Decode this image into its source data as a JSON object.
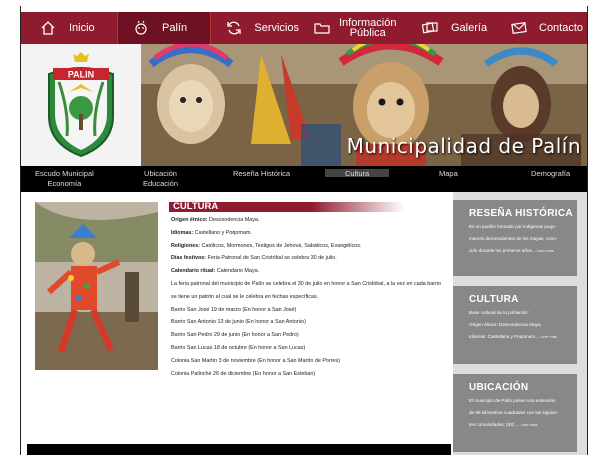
{
  "nav": {
    "items": [
      {
        "label": "Inicio",
        "icon": "house-icon"
      },
      {
        "label": "Palín",
        "icon": "mask-icon"
      },
      {
        "label": "Servicios",
        "icon": "refresh-icon"
      },
      {
        "label_line1": "Información",
        "label_line2": "Pública",
        "icon": "folder-icon"
      },
      {
        "label": "Galería",
        "icon": "photos-icon"
      },
      {
        "label": "Contacto",
        "icon": "envelope-icon"
      }
    ],
    "active_index": 1
  },
  "banner": {
    "title": "Municipalidad de Palín",
    "logo_text": "PALIN"
  },
  "subnav": {
    "items": [
      {
        "line1": "Escudo Municipal",
        "line2": "Economía"
      },
      {
        "line1": "Ubicación",
        "line2": "Educación"
      },
      {
        "line1": "Reseña Histórica",
        "line2": ""
      },
      {
        "line1": "Cultura",
        "line2": ""
      },
      {
        "line1": "Mapa",
        "line2": ""
      },
      {
        "line1": "Demografía",
        "line2": ""
      }
    ],
    "active_index": 3
  },
  "cultura": {
    "heading": "CULTURA",
    "rows": [
      {
        "label": "Origen étnico:",
        "value": "Descendencia Maya."
      },
      {
        "label": "Idiomas:",
        "value": "Castellano y Poqomam."
      },
      {
        "label": "Religiones:",
        "value": "Católicos, Mormones, Testigos de Jehová, Sabáticos, Evangélicos."
      },
      {
        "label": "Días festivos:",
        "value": "Feria Patronal de San Cristóbal se celebra 30 de julio."
      },
      {
        "label": "Calendario ritual:",
        "value": "Calendario Maya."
      }
    ],
    "paragraph_line1": "La feria patronal del municipio de Palín se celebra el 30 de julio en honor a San Cristóbal, a la vez en cada barrio",
    "paragraph_line2": "se tiene un patrón al cual se le celebra en fechas específicas.",
    "barrios": [
      "Barrio San José 19 de marzo (En honor a San José)",
      "Barrio San Antonio 13 de junio (En honor a San Antonio)",
      "Barrio San Pedro 29 de junio (En honor a San Pedro)",
      "Barrio San Lucas 18 de octubre (En honor a San Lucas)",
      "Colonia San Martín 3 de noviembre (En honor a San Martín de Porres)",
      "Colonia Palinché 26 de diciembre (En honor a San Esteban)"
    ]
  },
  "sidebar": {
    "resena": {
      "title": "RESEÑA HISTÓRICA",
      "line1": "Es un pueblo formado por indígenas poqo-",
      "line2": "mames descendientes de los mayas, cono-",
      "line3": "cido durante los primeros años...",
      "more": "Leer más"
    },
    "cultura": {
      "title": "CULTURA",
      "line1": "Base cultural de la población:",
      "line2": "Origen étnico: Descendencia Maya.",
      "line3": "Idiomas: Castellano y Poqomam...",
      "more": "Leer más"
    },
    "ubicacion": {
      "title": "UBICACIÓN",
      "line1": "El municipio de Palín posee una extensión",
      "line2": "de 88 kilómetros cuadrados con las siguien-",
      "line3": "tes comunidades: (62) ...",
      "more": "Leer más"
    }
  },
  "colors": {
    "brand": "#8e1b2e",
    "brand_dark": "#6e1122",
    "sidebar_box": "#888888"
  }
}
